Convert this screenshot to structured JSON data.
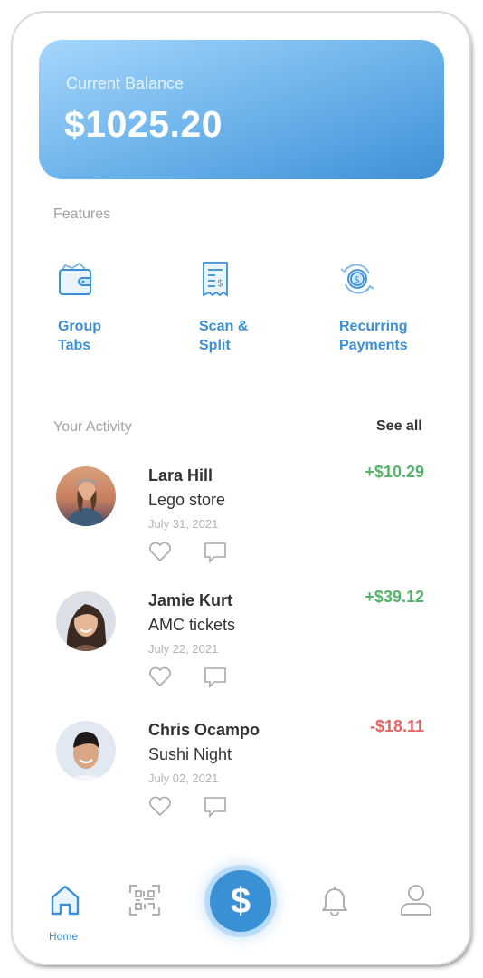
{
  "balance": {
    "label": "Current Balance",
    "amount": "$1025.20"
  },
  "features": {
    "title": "Features",
    "items": [
      {
        "label": "Group\nTabs",
        "icon": "wallet-icon"
      },
      {
        "label": "Scan &\nSplit",
        "icon": "receipt-icon"
      },
      {
        "label": "Recurring\nPayments",
        "icon": "recurring-payment-icon"
      }
    ]
  },
  "activity": {
    "title": "Your Activity",
    "see_all": "See all",
    "items": [
      {
        "name": "Lara Hill",
        "description": "Lego store",
        "date": "July 31, 2021",
        "amount": "+$10.29",
        "direction": "credit"
      },
      {
        "name": "Jamie Kurt",
        "description": "AMC tickets",
        "date": "July 22, 2021",
        "amount": "+$39.12",
        "direction": "credit"
      },
      {
        "name": "Chris Ocampo",
        "description": "Sushi Night",
        "date": "July 02, 2021",
        "amount": "-$18.11",
        "direction": "debit"
      }
    ]
  },
  "nav": {
    "home_label": "Home",
    "pay_symbol": "$",
    "items": [
      "home-icon",
      "qr-code-icon",
      "dollar-icon",
      "bell-icon",
      "user-icon"
    ]
  },
  "colors": {
    "accent": "#3b8fd6",
    "positive": "#54b36a",
    "negative": "#e06464"
  }
}
